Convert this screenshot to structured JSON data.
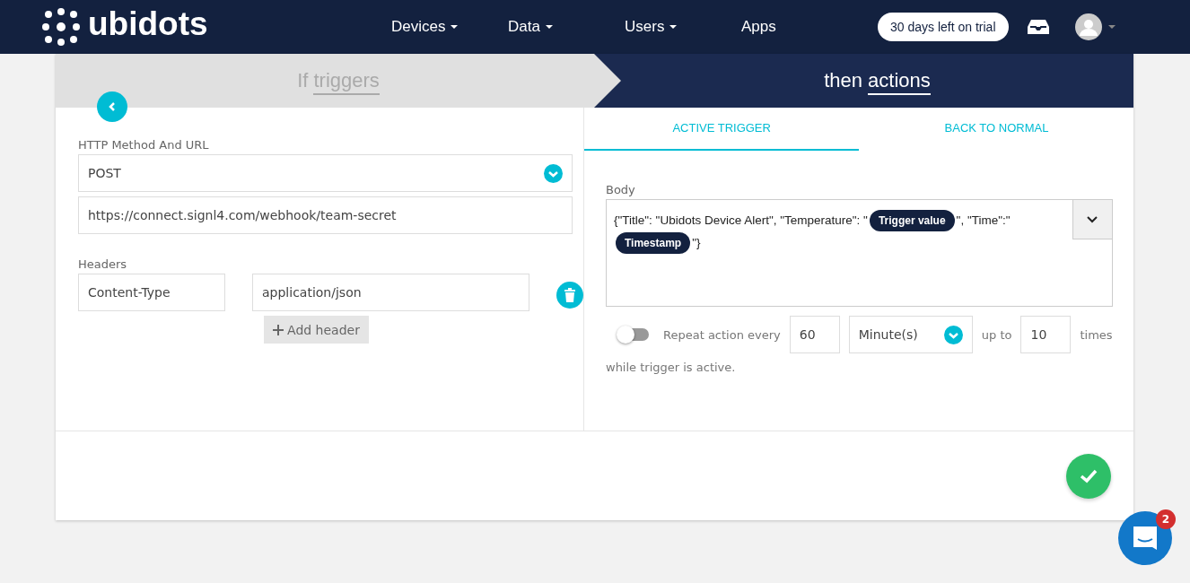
{
  "navbar": {
    "logo": "ubidots",
    "menu": [
      {
        "label": "Devices",
        "dropdown": true
      },
      {
        "label": "Data",
        "dropdown": true
      },
      {
        "label": "Users",
        "dropdown": true
      },
      {
        "label": "Apps",
        "dropdown": false
      }
    ],
    "trial_badge": "30 days left on trial"
  },
  "steps": [
    {
      "prefix": "If",
      "label": "triggers",
      "selected": false
    },
    {
      "prefix": "then",
      "label": "actions",
      "selected": true
    }
  ],
  "left_panel": {
    "method_label": "HTTP Method And URL",
    "method": "POST",
    "url": "https://connect.signl4.com/webhook/team-secret",
    "headers_label": "Headers",
    "headers": [
      {
        "key": "Content-Type",
        "value": "application/json"
      }
    ],
    "add_header": "Add header"
  },
  "tabs": [
    {
      "label": "ACTIVE TRIGGER",
      "selected": true
    },
    {
      "label": "BACK TO NORMAL",
      "selected": false
    }
  ],
  "body": {
    "label": "Body",
    "parts": [
      {
        "kind": "text",
        "text": "{\"Title\": \"Ubidots Device Alert\", \"Temperature\": \""
      },
      {
        "kind": "chip",
        "text": "Trigger value"
      },
      {
        "kind": "text",
        "text": "\", \"Time\":"
      },
      {
        "kind": "text",
        "text": "\""
      },
      {
        "kind": "chip",
        "text": "Timestamp"
      },
      {
        "kind": "text",
        "text": "\"}"
      }
    ]
  },
  "repeat": {
    "on": false,
    "label": "Repeat action every",
    "interval": "60",
    "unit": "Minute(s)",
    "up_to": "up to",
    "count": "10",
    "times": "times",
    "note": "while trigger is active."
  },
  "chat": {
    "badge": "2"
  }
}
